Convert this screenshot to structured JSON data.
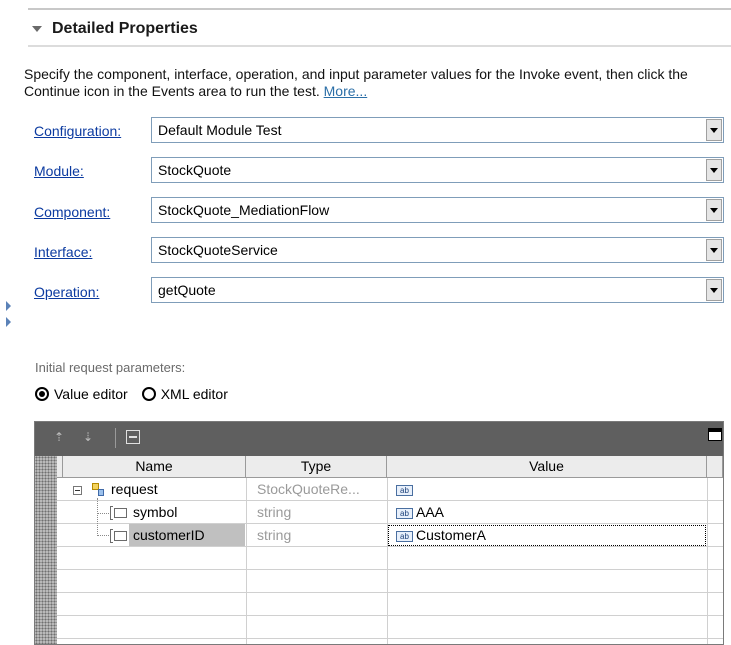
{
  "section": {
    "title": "Detailed Properties",
    "description": "Specify the component, interface, operation, and input parameter values for the Invoke event, then click the Continue icon in the Events area to run the test.",
    "more_link": "More..."
  },
  "fields": [
    {
      "label": "Configuration:",
      "value": "Default Module Test"
    },
    {
      "label": "Module:",
      "value": "StockQuote"
    },
    {
      "label": "Component:",
      "value": "StockQuote_MediationFlow"
    },
    {
      "label": "Interface:",
      "value": "StockQuoteService"
    },
    {
      "label": "Operation:",
      "value": "getQuote"
    }
  ],
  "params": {
    "label": "Initial request parameters:",
    "radio_value_editor": "Value editor",
    "radio_xml_editor": "XML editor",
    "selected": "Value editor"
  },
  "table": {
    "headers": {
      "name": "Name",
      "type": "Type",
      "value": "Value"
    },
    "rows": [
      {
        "name": "request",
        "type": "StockQuoteRe...",
        "value": ""
      },
      {
        "name": "symbol",
        "type": "string",
        "value": "AAA"
      },
      {
        "name": "customerID",
        "type": "string",
        "value": "CustomerA"
      }
    ]
  },
  "icons": {
    "section_toggle": "triangle-down-icon",
    "move_up": "move-up-icon",
    "move_down": "move-down-icon",
    "collapse_all": "collapse-all-icon",
    "maximize": "maximize-icon",
    "string_value": "string-value-icon"
  },
  "colors": {
    "link": "#0b3aa0",
    "toolbar": "#5f5f5f",
    "selection": "#c0c0c0"
  }
}
